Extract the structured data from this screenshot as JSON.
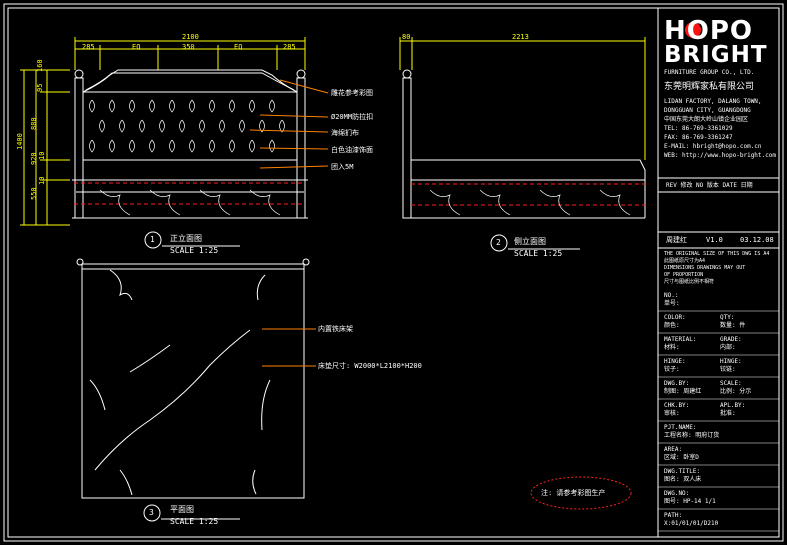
{
  "colors": {
    "background": "#000000",
    "line": "#ffffff",
    "dim": "#ffff00",
    "leader": "#ff8000",
    "dashed": "#ff2020",
    "logo_dot": "#ff1010"
  },
  "front_view": {
    "total_width": "2100",
    "segments": [
      "285",
      "EQ",
      "350",
      "EQ",
      "285"
    ],
    "left_dims": [
      "160",
      "95",
      "880",
      "1400",
      "10",
      "920",
      "10",
      "550"
    ],
    "label_num": "1",
    "label_title": "正立面图",
    "label_scale": "SCALE 1:25"
  },
  "annotations": [
    "雕花参考彩图",
    "Ø20MM防拉扣",
    "海绵扪布",
    "白色油漆饰面",
    "团入5M"
  ],
  "side_view": {
    "dim_left": "80",
    "dim_total": "2213",
    "label_num": "2",
    "label_title": "侧立面图",
    "label_scale": "SCALE 1:25"
  },
  "plan_view": {
    "note1": "内置铁床架",
    "note2": "床垫尺寸: W2000*L2100*H200",
    "label_num": "3",
    "label_title": "平面图",
    "label_scale": "SCALE 1:25"
  },
  "footnote": "注: 请参考彩图生产",
  "title_block": {
    "logo_line1": "HOPO",
    "logo_line2": "BRIGHT",
    "group": "FURNITURE GROUP CO., LTD.",
    "company_cn": "东莞明辉家私有限公司",
    "address_lines": [
      "LIDAN FACTORY, DALANG TOWN,",
      "DONGGUAN CITY, GUANGDONG",
      "中国东莞大朗大岭山镇企业园区",
      "TEL: 86-769-3361029",
      "FAX: 86-769-3361247",
      "E-MAIL: hbright@hopo.com.cn",
      "WEB: http://www.hopo-bright.com"
    ],
    "rev_header": "REV 修改  NO 版本  DATE 日期",
    "drawer": "周建红",
    "version": "V1.0",
    "date": "03.12.08",
    "notes": [
      "THE ORIGINAL SIZE OF THIS DWG IS A4",
      "此图纸原尺寸为A4",
      "DIMENSIONS DRAWINGS MAY OUT",
      "OF PROPORTION",
      "尺寸与图纸比例不相符"
    ],
    "rows": [
      {
        "l1": "NO.:",
        "l2": "单号:",
        "r1": "",
        "r2": ""
      },
      {
        "l1": "COLOR:",
        "l2": "颜色:",
        "r1": "QTY:",
        "r2": "数量:   件"
      },
      {
        "l1": "MATERIAL:",
        "l2": "材料:",
        "r1": "GRADE:",
        "r2": "内部:"
      },
      {
        "l1": "HINGE:",
        "l2": "铰子:",
        "r1": "HINGE:",
        "r2": "铰链:"
      },
      {
        "l1": "DWG.BY:",
        "l2": "制图:  周建红",
        "r1": "SCALE:",
        "r2": "比例:  分示"
      },
      {
        "l1": "CHK.BY:",
        "l2": "审核:",
        "r1": "APL.BY:",
        "r2": "批准:"
      },
      {
        "l1": "PJT.NAME:",
        "l2": "工程名称:    明府订货",
        "r1": "",
        "r2": ""
      },
      {
        "l1": "AREA:",
        "l2": "区域:       卧室D",
        "r1": "",
        "r2": ""
      },
      {
        "l1": "DWG.TITLE:",
        "l2": "图名:       双人床",
        "r1": "",
        "r2": ""
      },
      {
        "l1": "DWG.NO:",
        "l2": "图号:       HP-14    1/1",
        "r1": "",
        "r2": ""
      },
      {
        "l1": "PATH:",
        "l2": "X:01/01/01/D210",
        "r1": "",
        "r2": ""
      }
    ]
  }
}
